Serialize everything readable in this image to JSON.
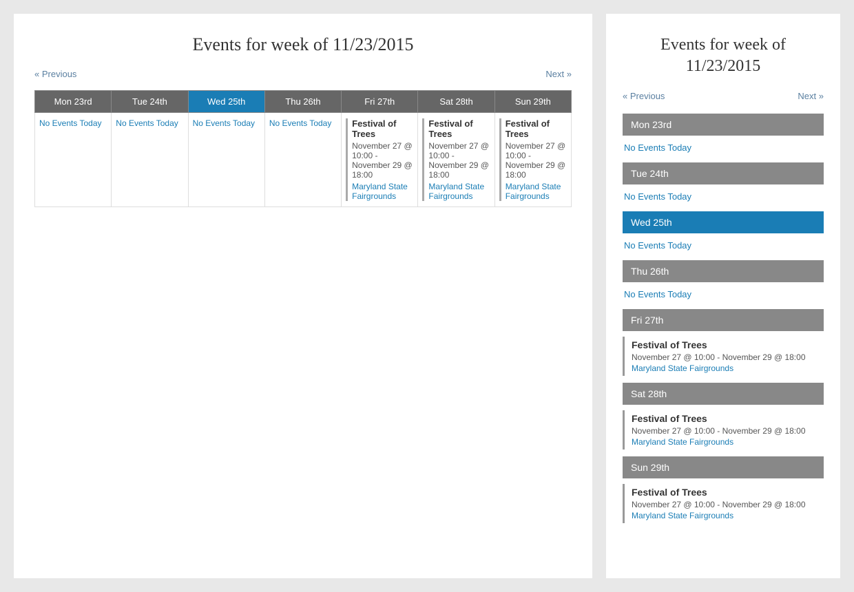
{
  "page": {
    "title": "Events for week of 11/23/2015",
    "prev_label": "« Previous",
    "next_label": "Next »"
  },
  "right_panel": {
    "title": "Events for week of 11/23/2015",
    "prev_label": "« Previous",
    "next_label": "Next »"
  },
  "days": [
    {
      "label": "Mon 23rd",
      "active": false,
      "no_events": true,
      "no_events_text": "No Events Today",
      "events": []
    },
    {
      "label": "Tue 24th",
      "active": false,
      "no_events": true,
      "no_events_text": "No Events Today",
      "events": []
    },
    {
      "label": "Wed 25th",
      "active": true,
      "no_events": true,
      "no_events_text": "No Events Today",
      "events": []
    },
    {
      "label": "Thu 26th",
      "active": false,
      "no_events": true,
      "no_events_text": "No Events Today",
      "events": []
    },
    {
      "label": "Fri 27th",
      "active": false,
      "no_events": false,
      "no_events_text": "",
      "events": [
        {
          "title": "Festival of Trees",
          "time": "November 27 @ 10:00 - November 29 @ 18:00",
          "location": "Maryland State Fairgrounds"
        }
      ]
    },
    {
      "label": "Sat 28th",
      "active": false,
      "no_events": false,
      "no_events_text": "",
      "events": [
        {
          "title": "Festival of Trees",
          "time": "November 27 @ 10:00 - November 29 @ 18:00",
          "location": "Maryland State Fairgrounds"
        }
      ]
    },
    {
      "label": "Sun 29th",
      "active": false,
      "no_events": false,
      "no_events_text": "",
      "events": [
        {
          "title": "Festival of Trees",
          "time": "November 27 @ 10:00 - November 29 @ 18:00",
          "location": "Maryland State Fairgrounds"
        }
      ]
    }
  ]
}
